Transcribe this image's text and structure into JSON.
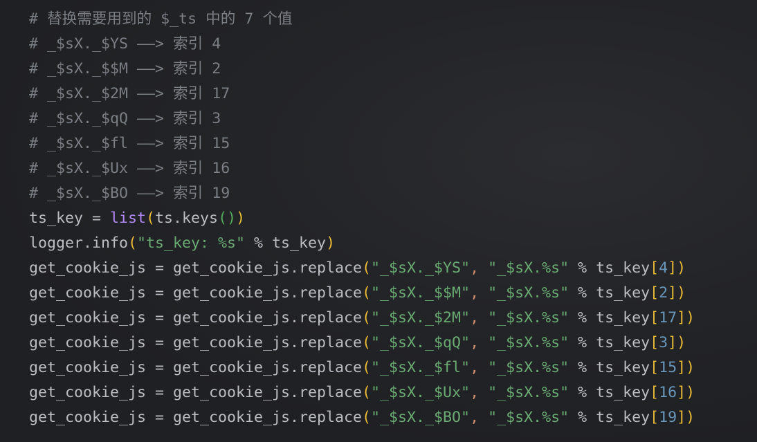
{
  "colors": {
    "background": "#1f2023",
    "text": "#bcbec4",
    "comment": "#7a7e85",
    "string": "#6aab73",
    "builtin": "#b189f5",
    "number": "#6897bb",
    "bracket_outer": "#e8ba36",
    "bracket_inner": "#54a857",
    "comma": "#cf8e6d"
  },
  "lines": [
    [
      [
        "# 替换需要用到的 $_ts 中的 7 个值",
        "c"
      ]
    ],
    [
      [
        "# _$sX._$YS ——> 索引 4",
        "c"
      ]
    ],
    [
      [
        "# _$sX._$$M ——> 索引 2",
        "c"
      ]
    ],
    [
      [
        "# _$sX._$2M ——> 索引 17",
        "c"
      ]
    ],
    [
      [
        "# _$sX._$qQ ——> 索引 3",
        "c"
      ]
    ],
    [
      [
        "# _$sX._$fl ——> 索引 15",
        "c"
      ]
    ],
    [
      [
        "# _$sX._$Ux ——> 索引 16",
        "c"
      ]
    ],
    [
      [
        "# _$sX._$BO ——> 索引 19",
        "c"
      ]
    ],
    [
      [
        "ts_key = ",
        "t"
      ],
      [
        "list",
        "b"
      ],
      [
        "(",
        "y"
      ],
      [
        "ts.keys",
        "t"
      ],
      [
        "()",
        "g"
      ],
      [
        ")",
        "y"
      ]
    ],
    [
      [
        "logger.info",
        "t"
      ],
      [
        "(",
        "y"
      ],
      [
        "\"ts_key: %s\"",
        "s"
      ],
      [
        " % ts_key",
        "t"
      ],
      [
        ")",
        "y"
      ]
    ],
    [
      [
        "get_cookie_js = get_cookie_js.replace",
        "t"
      ],
      [
        "(",
        "y"
      ],
      [
        "\"_$sX._$YS\"",
        "s"
      ],
      [
        ",",
        "o"
      ],
      [
        " ",
        "t"
      ],
      [
        "\"_$sX.%s\"",
        "s"
      ],
      [
        " % ts_key",
        "t"
      ],
      [
        "[",
        "y"
      ],
      [
        "4",
        "n"
      ],
      [
        "]",
        "y"
      ],
      [
        ")",
        "y"
      ]
    ],
    [
      [
        "get_cookie_js = get_cookie_js.replace",
        "t"
      ],
      [
        "(",
        "y"
      ],
      [
        "\"_$sX._$$M\"",
        "s"
      ],
      [
        ",",
        "o"
      ],
      [
        " ",
        "t"
      ],
      [
        "\"_$sX.%s\"",
        "s"
      ],
      [
        " % ts_key",
        "t"
      ],
      [
        "[",
        "y"
      ],
      [
        "2",
        "n"
      ],
      [
        "]",
        "y"
      ],
      [
        ")",
        "y"
      ]
    ],
    [
      [
        "get_cookie_js = get_cookie_js.replace",
        "t"
      ],
      [
        "(",
        "y"
      ],
      [
        "\"_$sX._$2M\"",
        "s"
      ],
      [
        ",",
        "o"
      ],
      [
        " ",
        "t"
      ],
      [
        "\"_$sX.%s\"",
        "s"
      ],
      [
        " % ts_key",
        "t"
      ],
      [
        "[",
        "y"
      ],
      [
        "17",
        "n"
      ],
      [
        "]",
        "y"
      ],
      [
        ")",
        "y"
      ]
    ],
    [
      [
        "get_cookie_js = get_cookie_js.replace",
        "t"
      ],
      [
        "(",
        "y"
      ],
      [
        "\"_$sX._$qQ\"",
        "s"
      ],
      [
        ",",
        "o"
      ],
      [
        " ",
        "t"
      ],
      [
        "\"_$sX.%s\"",
        "s"
      ],
      [
        " % ts_key",
        "t"
      ],
      [
        "[",
        "y"
      ],
      [
        "3",
        "n"
      ],
      [
        "]",
        "y"
      ],
      [
        ")",
        "y"
      ]
    ],
    [
      [
        "get_cookie_js = get_cookie_js.replace",
        "t"
      ],
      [
        "(",
        "y"
      ],
      [
        "\"_$sX._$fl\"",
        "s"
      ],
      [
        ",",
        "o"
      ],
      [
        " ",
        "t"
      ],
      [
        "\"_$sX.%s\"",
        "s"
      ],
      [
        " % ts_key",
        "t"
      ],
      [
        "[",
        "y"
      ],
      [
        "15",
        "n"
      ],
      [
        "]",
        "y"
      ],
      [
        ")",
        "y"
      ]
    ],
    [
      [
        "get_cookie_js = get_cookie_js.replace",
        "t"
      ],
      [
        "(",
        "y"
      ],
      [
        "\"_$sX._$Ux\"",
        "s"
      ],
      [
        ",",
        "o"
      ],
      [
        " ",
        "t"
      ],
      [
        "\"_$sX.%s\"",
        "s"
      ],
      [
        " % ts_key",
        "t"
      ],
      [
        "[",
        "y"
      ],
      [
        "16",
        "n"
      ],
      [
        "]",
        "y"
      ],
      [
        ")",
        "y"
      ]
    ],
    [
      [
        "get_cookie_js = get_cookie_js.replace",
        "t"
      ],
      [
        "(",
        "y"
      ],
      [
        "\"_$sX._$BO\"",
        "s"
      ],
      [
        ",",
        "o"
      ],
      [
        " ",
        "t"
      ],
      [
        "\"_$sX.%s\"",
        "s"
      ],
      [
        " % ts_key",
        "t"
      ],
      [
        "[",
        "y"
      ],
      [
        "19",
        "n"
      ],
      [
        "]",
        "y"
      ],
      [
        ")",
        "y"
      ]
    ]
  ]
}
